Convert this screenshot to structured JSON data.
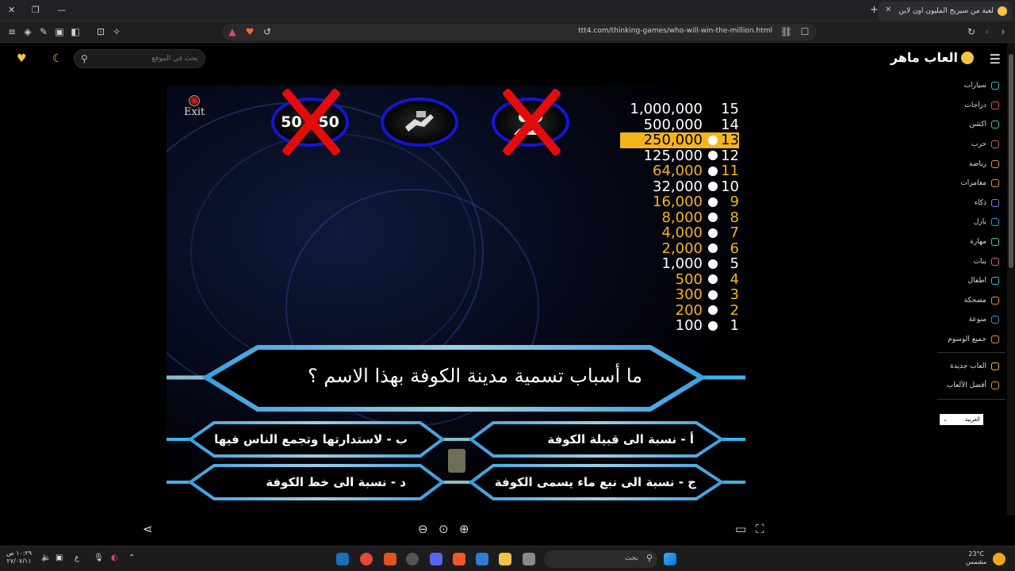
{
  "browser": {
    "tab_title": "لعبة من سيربح المليون اون لاين",
    "url": "ttt4.com/thinking-games/who-will-win-the-million.html"
  },
  "site": {
    "logo_text": "العاب ماهر",
    "search_placeholder": "بحث في الموقع",
    "nav": [
      {
        "label": "سيارات",
        "color": "#34b8e0"
      },
      {
        "label": "دراجات",
        "color": "#e05656"
      },
      {
        "label": "اكشن",
        "color": "#4ecb71"
      },
      {
        "label": "حرب",
        "color": "#e05656"
      },
      {
        "label": "رياضة",
        "color": "#f08a3c"
      },
      {
        "label": "مغامرات",
        "color": "#f08a3c"
      },
      {
        "label": "ذكاء",
        "color": "#9b6cf0"
      },
      {
        "label": "بازل",
        "color": "#3b8fe0"
      },
      {
        "label": "مهارة",
        "color": "#4ecb71"
      },
      {
        "label": "بنات",
        "color": "#e0559b"
      },
      {
        "label": "اطفال",
        "color": "#34b8e0"
      },
      {
        "label": "مضحكة",
        "color": "#f08a3c"
      },
      {
        "label": "منوعة",
        "color": "#3b8fe0"
      },
      {
        "label": "جميع الوسوم",
        "color": "#f08a3c"
      }
    ],
    "nav2": [
      {
        "label": "العاب جديدة",
        "color": "#f6c343"
      },
      {
        "label": "أفضل الألعاب",
        "color": "#f08a3c"
      }
    ],
    "language": "العربية"
  },
  "game": {
    "exit_label": "Exit",
    "lifelines": {
      "fifty_fifty": {
        "label": "50 : 50",
        "used": true
      },
      "phone": {
        "used": false
      },
      "audience": {
        "used": true
      }
    },
    "money_ladder": [
      {
        "level": "15",
        "amount": "1,000,000",
        "style": "white",
        "done": false
      },
      {
        "level": "14",
        "amount": "500,000",
        "style": "white",
        "done": false
      },
      {
        "level": "13",
        "amount": "250,000",
        "style": "current",
        "done": true
      },
      {
        "level": "12",
        "amount": "125,000",
        "style": "white",
        "done": true
      },
      {
        "level": "11",
        "amount": "64,000",
        "style": "gold",
        "done": true
      },
      {
        "level": "10",
        "amount": "32,000",
        "style": "white",
        "done": true
      },
      {
        "level": "9",
        "amount": "16,000",
        "style": "gold",
        "done": true
      },
      {
        "level": "8",
        "amount": "8,000",
        "style": "gold",
        "done": true
      },
      {
        "level": "7",
        "amount": "4,000",
        "style": "gold",
        "done": true
      },
      {
        "level": "6",
        "amount": "2,000",
        "style": "gold",
        "done": true
      },
      {
        "level": "5",
        "amount": "1,000",
        "style": "white",
        "done": true
      },
      {
        "level": "4",
        "amount": "500",
        "style": "gold",
        "done": true
      },
      {
        "level": "3",
        "amount": "300",
        "style": "gold",
        "done": true
      },
      {
        "level": "2",
        "amount": "200",
        "style": "gold",
        "done": true
      },
      {
        "level": "1",
        "amount": "100",
        "style": "white",
        "done": true
      }
    ],
    "question": "ما أسباب تسمية مدينة الكوفة بهذا الاسم ؟",
    "answers": {
      "a": "أ - نسبة الى قبيلة الكوفة",
      "b": "ب - لاستدارتها وتجمع الناس فيها",
      "c": "ج - نسبة الى نبع ماء يسمى الكوفة",
      "d": "د - نسبة الى خط الكوفة"
    }
  },
  "taskbar": {
    "search_placeholder": "بحث",
    "weather_temp": "23°C",
    "weather_desc": "مشمس",
    "time": "١٠:٢٩ ص",
    "date": "٢٧/٠٧/١١",
    "lang": "ع"
  }
}
